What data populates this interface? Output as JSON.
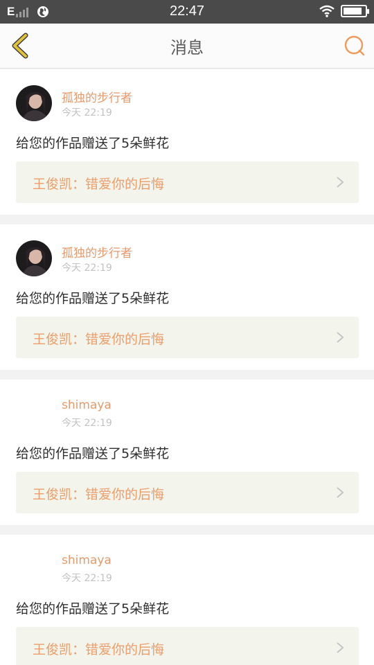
{
  "status_bar": {
    "network": "E",
    "time": "22:47",
    "battery_level": 0.85
  },
  "header": {
    "title": "消息",
    "back_icon": "chevron-left-icon",
    "search_icon": "search-icon"
  },
  "colors": {
    "accent": "#e8996a",
    "back_arrow": "#e2c23a",
    "card_link_bg": "#f3f4ec",
    "status_bar": "#4a4a4a"
  },
  "messages": [
    {
      "username": "孤独的步行者",
      "time": "今天 22:19",
      "text": "给您的作品赠送了5朵鲜花",
      "work": "王俊凯：错爱你的后悔",
      "has_avatar": true
    },
    {
      "username": "孤独的步行者",
      "time": "今天 22:19",
      "text": "给您的作品赠送了5朵鲜花",
      "work": "王俊凯：错爱你的后悔",
      "has_avatar": true
    },
    {
      "username": "shimaya",
      "time": "今天 22:19",
      "text": "给您的作品赠送了5朵鲜花",
      "work": "王俊凯：错爱你的后悔",
      "has_avatar": false
    },
    {
      "username": "shimaya",
      "time": "今天 22:19",
      "text": "给您的作品赠送了5朵鲜花",
      "work": "王俊凯：错爱你的后悔",
      "has_avatar": false
    }
  ]
}
